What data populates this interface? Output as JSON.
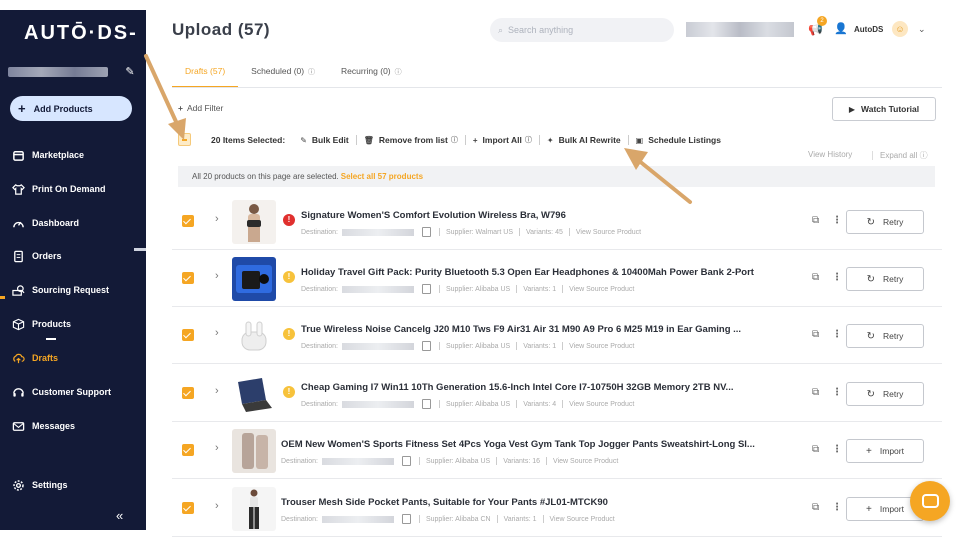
{
  "sidebar": {
    "logo": "AUTŌ·DS-",
    "add_products": "Add Products",
    "items": [
      {
        "label": "Marketplace",
        "icon": "store-icon"
      },
      {
        "label": "Print On Demand",
        "icon": "shirt-icon"
      },
      {
        "label": "Dashboard",
        "icon": "gauge-icon"
      },
      {
        "label": "Orders",
        "icon": "list-icon"
      },
      {
        "label": "Sourcing Request",
        "icon": "sourcing-icon"
      },
      {
        "label": "Products",
        "icon": "box-icon"
      },
      {
        "label": "Drafts",
        "icon": "cloud-upload-icon",
        "active": true
      },
      {
        "label": "Customer Support",
        "icon": "headset-icon"
      },
      {
        "label": "Messages",
        "icon": "mail-icon"
      }
    ],
    "settings": "Settings",
    "collapse": "«"
  },
  "header": {
    "title": "Upload (57)",
    "search_placeholder": "Search anything",
    "notif_count": "2",
    "user": "AutoDS"
  },
  "tabs": [
    {
      "label": "Drafts (57)",
      "active": true,
      "help": false
    },
    {
      "label": "Scheduled (0)",
      "active": false,
      "help": true
    },
    {
      "label": "Recurring (0)",
      "active": false,
      "help": true
    }
  ],
  "toolbar": {
    "add_filter": "Add Filter",
    "watch_tutorial": "Watch Tutorial",
    "selected": "20 Items Selected:",
    "bulk_edit": "Bulk Edit",
    "remove": "Remove from list",
    "import_all": "Import All",
    "bulk_ai": "Bulk AI Rewrite",
    "schedule": "Schedule Listings",
    "view_history": "View History",
    "expand_all": "Expand all"
  },
  "notice": {
    "text": "All 20 products on this page are selected.",
    "link": "Select all 57 products"
  },
  "labels": {
    "destination": "Destination:",
    "view_source": "View Source Product"
  },
  "products": [
    {
      "title": "Signature Women'S Comfort Evolution Wireless Bra, W796",
      "status": "error",
      "supplier": "Supplier: Walmart US",
      "variants": "Variants: 45",
      "action": "Retry"
    },
    {
      "title": "Holiday Travel Gift Pack: Purity Bluetooth 5.3 Open Ear Headphones & 10400Mah Power Bank 2-Port",
      "status": "warning",
      "supplier": "Supplier: Alibaba US",
      "variants": "Variants: 1",
      "action": "Retry"
    },
    {
      "title": "True Wireless Noise Cancelg J20 M10 Tws F9 Air31 Air 31 M90 A9 Pro 6 M25 M19 in Ear Gaming ...",
      "status": "warning",
      "supplier": "Supplier: Alibaba US",
      "variants": "Variants: 1",
      "action": "Retry"
    },
    {
      "title": "Cheap Gaming I7 Win11 10Th Generation 15.6-Inch Intel Core I7-10750H 32GB Memory 2TB NV...",
      "status": "warning",
      "supplier": "Supplier: Alibaba US",
      "variants": "Variants: 4",
      "action": "Retry"
    },
    {
      "title": "OEM New Women'S Sports Fitness Set 4Pcs Yoga Vest Gym Tank Top Jogger Pants Sweatshirt-Long Sl...",
      "status": "none",
      "supplier": "Supplier: Alibaba US",
      "variants": "Variants: 16",
      "action": "Import"
    },
    {
      "title": "Trouser Mesh Side Pocket Pants, Suitable for Your Pants #JL01-MTCK90",
      "status": "none",
      "supplier": "Supplier: Alibaba CN",
      "variants": "Variants: 1",
      "action": "Import"
    }
  ],
  "colors": {
    "accent": "#f5a623",
    "sidebar_bg": "#131a37",
    "error": "#e0302e",
    "warning": "#f7c23b"
  }
}
